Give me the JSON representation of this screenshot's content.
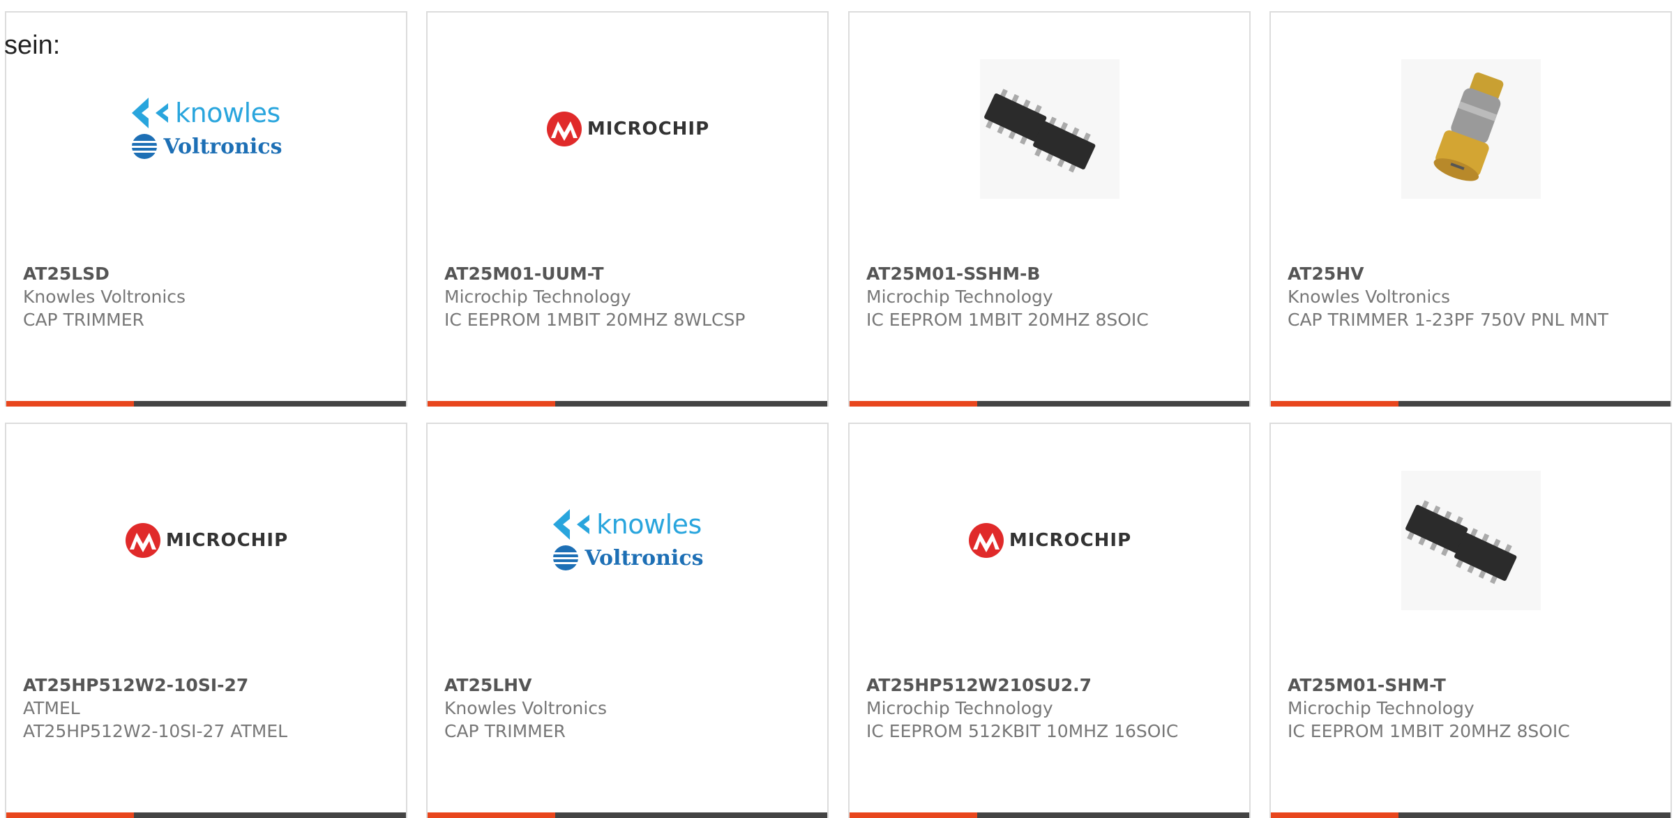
{
  "intro_text": "sein:",
  "colors": {
    "accent": "#e8461d",
    "bar": "#444444",
    "border": "#dcdcdc",
    "knowles_blue": "#29a5dd",
    "voltronics_blue": "#1d6fb5",
    "microchip_red": "#e02a2a"
  },
  "products": [
    {
      "mpn": "AT25LSD",
      "manufacturer": "Knowles Voltronics",
      "description": "CAP TRIMMER",
      "image": "knowles-voltronics-logo",
      "logo_top": "knowles",
      "logo_bottom": "Voltronics"
    },
    {
      "mpn": "AT25M01-UUM-T",
      "manufacturer": "Microchip Technology",
      "description": "IC EEPROM 1MBIT 20MHZ 8WLCSP",
      "image": "microchip-logo",
      "logo_text": "MICROCHIP"
    },
    {
      "mpn": "AT25M01-SSHM-B",
      "manufacturer": "Microchip Technology",
      "description": "IC EEPROM 1MBIT 20MHZ 8SOIC",
      "image": "soic-chip-photo"
    },
    {
      "mpn": "AT25HV",
      "manufacturer": "Knowles Voltronics",
      "description": "CAP TRIMMER 1-23PF 750V PNL MNT",
      "image": "trimmer-capacitor-photo"
    },
    {
      "mpn": "AT25HP512W2-10SI-27",
      "manufacturer": "ATMEL",
      "description": "AT25HP512W2-10SI-27 ATMEL",
      "image": "microchip-logo",
      "logo_text": "MICROCHIP"
    },
    {
      "mpn": "AT25LHV",
      "manufacturer": "Knowles Voltronics",
      "description": "CAP TRIMMER",
      "image": "knowles-voltronics-logo",
      "logo_top": "knowles",
      "logo_bottom": "Voltronics"
    },
    {
      "mpn": "AT25HP512W210SU2.7",
      "manufacturer": "Microchip Technology",
      "description": "IC EEPROM 512KBIT 10MHZ 16SOIC",
      "image": "microchip-logo",
      "logo_text": "MICROCHIP"
    },
    {
      "mpn": "AT25M01-SHM-T",
      "manufacturer": "Microchip Technology",
      "description": "IC EEPROM 1MBIT 20MHZ 8SOIC",
      "image": "soic-chip-photo"
    }
  ]
}
